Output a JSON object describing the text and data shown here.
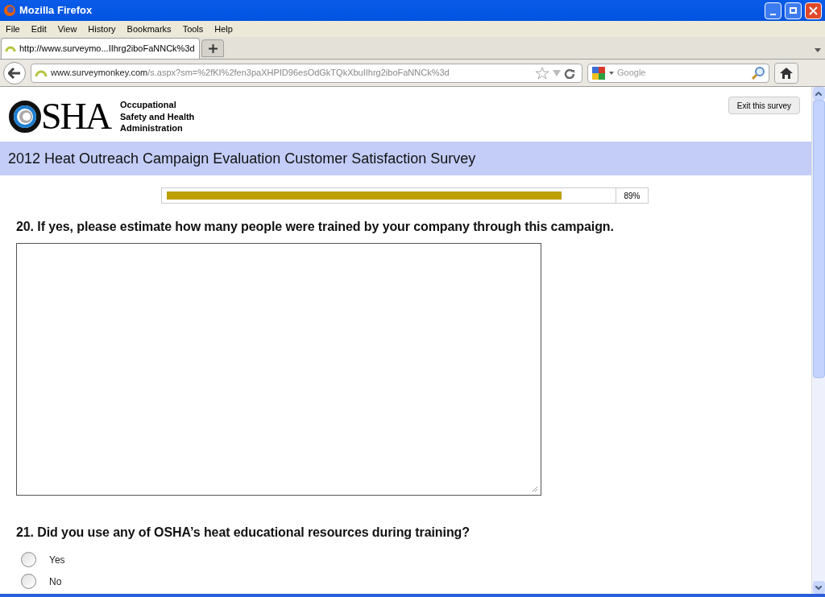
{
  "window": {
    "title": "Mozilla Firefox"
  },
  "menu": [
    "File",
    "Edit",
    "View",
    "History",
    "Bookmarks",
    "Tools",
    "Help"
  ],
  "tabs": [
    {
      "label": "http://www.surveymo...IIhrg2iboFaNNCk%3d",
      "selected": true
    }
  ],
  "address": {
    "host": "www.surveymonkey.com",
    "path": "/s.aspx?sm=%2fKI%2fen3paXHPID96esOdGkTQkXbuIIhrg2iboFaNNCk%3d"
  },
  "search": {
    "placeholder": "Google"
  },
  "header": {
    "logo_text": "SHA",
    "org_lines": [
      "Occupational",
      "Safety and Health",
      "Administration"
    ],
    "exit_button": "Exit this survey"
  },
  "survey_title": "2012 Heat Outreach Campaign Evaluation Customer Satisfaction Survey",
  "progress": {
    "level": 0.89,
    "reading": "89%"
  },
  "questions": [
    {
      "kind": "textarea",
      "text": "20. If yes, please estimate how many people were trained by your company through this campaign."
    },
    {
      "kind": "radio",
      "text": "21. Did you use any of OSHA’s heat educational resources during training?",
      "options": [
        {
          "label": "Yes",
          "selected": false
        },
        {
          "label": "No",
          "selected": false
        }
      ]
    }
  ]
}
